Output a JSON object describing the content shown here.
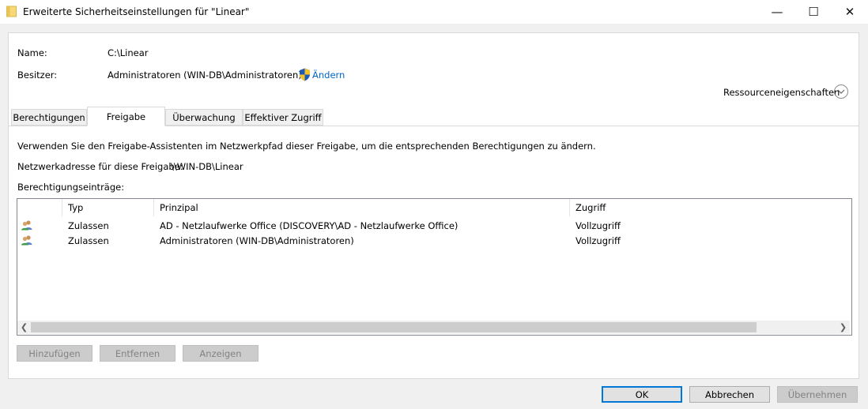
{
  "window": {
    "title": "Erweiterte Sicherheitseinstellungen für \"Linear\"",
    "minimize_glyph": "—",
    "maximize_glyph": "☐",
    "close_glyph": "✕"
  },
  "header": {
    "name_label": "Name:",
    "name_value": "C:\\Linear",
    "owner_label": "Besitzer:",
    "owner_value": "Administratoren (WIN-DB\\Administratoren)",
    "change_link": "Ändern",
    "resource_props": "Ressourceneigenschaften"
  },
  "tabs": [
    "Berechtigungen",
    "Freigabe",
    "Überwachung",
    "Effektiver Zugriff"
  ],
  "active_tab": "Freigabe",
  "content": {
    "info_text": "Verwenden Sie den Freigabe-Assistenten im Netzwerkpfad dieser Freigabe, um die entsprechenden Berechtigungen zu ändern.",
    "network_label": "Netzwerkadresse für diese Freigabe:",
    "network_value": "\\\\WIN-DB\\Linear",
    "entries_label": "Berechtigungseinträge:"
  },
  "table": {
    "columns": [
      "Typ",
      "Prinzipal",
      "Zugriff"
    ],
    "rows": [
      {
        "type": "Zulassen",
        "principal": "AD - Netzlaufwerke Office (DISCOVERY\\AD - Netzlaufwerke Office)",
        "access": "Vollzugriff",
        "icon": "user-group-icon"
      },
      {
        "type": "Zulassen",
        "principal": "Administratoren (WIN-DB\\Administratoren)",
        "access": "Vollzugriff",
        "icon": "user-group-icon"
      }
    ]
  },
  "panel_buttons": {
    "add": "Hinzufügen",
    "remove": "Entfernen",
    "view": "Anzeigen"
  },
  "dialog_buttons": {
    "ok": "OK",
    "cancel": "Abbrechen",
    "apply": "Übernehmen"
  },
  "colors": {
    "link": "#0066cc",
    "ok_border": "#0078d7",
    "disabled_text": "#838383"
  }
}
